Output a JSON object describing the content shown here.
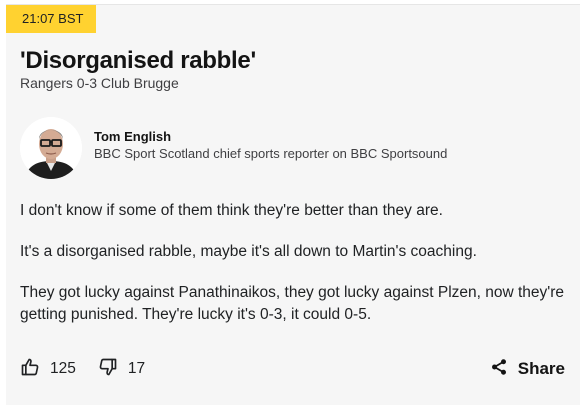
{
  "post": {
    "timestamp": "21:07 BST",
    "headline": "'Disorganised rabble'",
    "subheadline": "Rangers 0-3 Club Brugge",
    "author": {
      "name": "Tom English",
      "role": "BBC Sport Scotland chief sports reporter on BBC Sportsound"
    },
    "paragraphs": [
      "I don't know if some of them think they're better than they are.",
      "It's a disorganised rabble, maybe it's all down to Martin's coaching.",
      "They got lucky against Panathinaikos, they got lucky against Plzen, now they're getting punished. They're lucky it's 0-3, it could 0-5."
    ]
  },
  "actions": {
    "like_icon": "thumbs-up-icon",
    "like_count": "125",
    "dislike_icon": "thumbs-down-icon",
    "dislike_count": "17",
    "share_icon": "share-icon",
    "share_label": "Share"
  },
  "colors": {
    "timestamp_bg": "#ffd230",
    "card_bg": "#f6f6f6",
    "text": "#141414"
  }
}
